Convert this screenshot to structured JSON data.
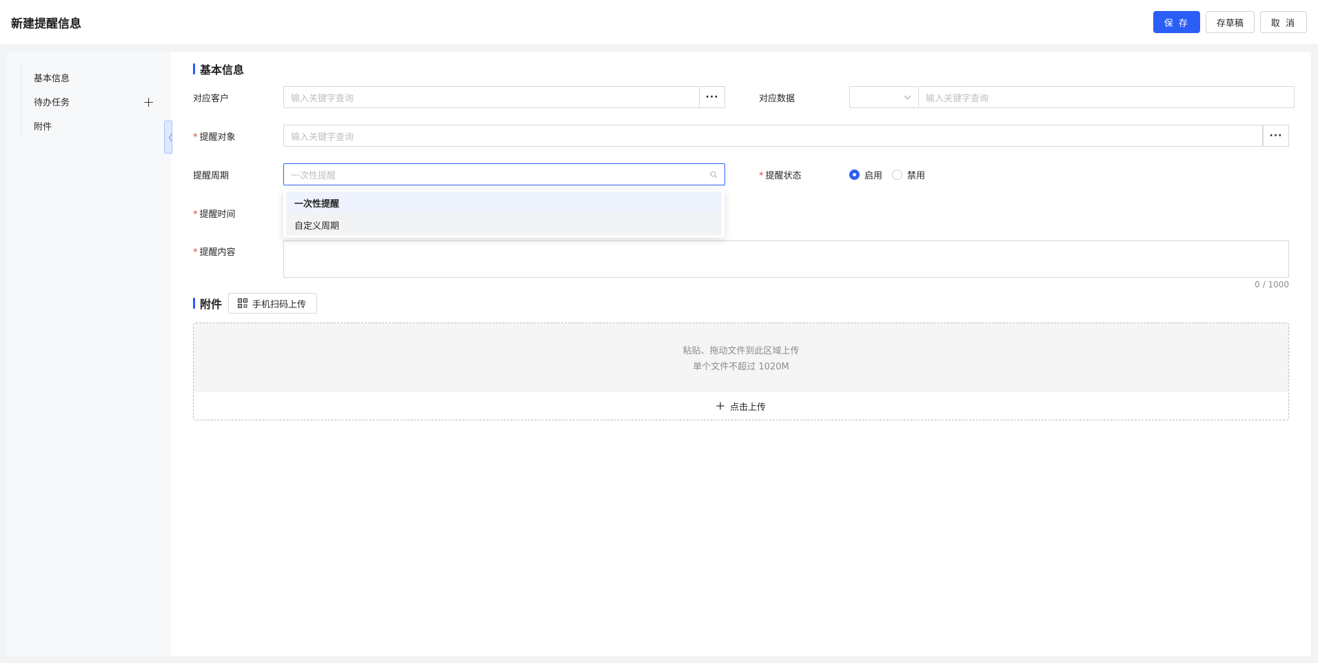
{
  "header": {
    "title": "新建提醒信息",
    "save_label": "保 存",
    "draft_label": "存草稿",
    "cancel_label": "取 消"
  },
  "sidebar": {
    "items": [
      {
        "label": "基本信息"
      },
      {
        "label": "待办任务",
        "has_add": true
      },
      {
        "label": "附件"
      }
    ],
    "add_symbol": "+",
    "collapse_symbol": "〈"
  },
  "basic_info": {
    "section_title": "基本信息",
    "customer": {
      "label": "对应客户",
      "placeholder": "输入关键字查询",
      "more": "···"
    },
    "data": {
      "label": "对应数据",
      "placeholder": "输入关键字查询"
    },
    "target": {
      "label": "提醒对象",
      "placeholder": "输入关键字查询",
      "more": "···"
    },
    "period": {
      "label": "提醒周期",
      "placeholder": "一次性提醒"
    },
    "status": {
      "label": "提醒状态",
      "options": [
        "启用",
        "禁用"
      ],
      "selected": "启用"
    },
    "time": {
      "label": "提醒时间"
    },
    "content": {
      "label": "提醒内容",
      "counter": "0 / 1000"
    }
  },
  "dropdown": {
    "options": [
      "一次性提醒",
      "自定义周期"
    ],
    "selected": "一次性提醒",
    "hovered": "自定义周期"
  },
  "attachments": {
    "section_title": "附件",
    "qr_label": "手机扫码上传",
    "drop_hint": "粘贴、拖动文件到此区域上传",
    "size_hint": "单个文件不超过 1020M",
    "upload_label": "点击上传"
  },
  "colors": {
    "accent": "#2a5ef5",
    "required": "#e8433a",
    "page_bg": "#f2f3f5",
    "sidebar_bg": "#f7f8fa"
  }
}
